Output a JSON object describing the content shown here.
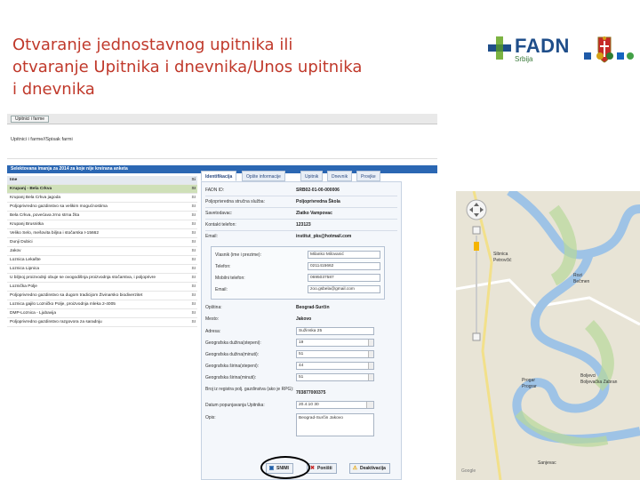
{
  "slide": {
    "title": "Otvaranje jednostavnog upitnika ili otvaranje Upitnika i dnevnika/Unos upitnika i dnevnika",
    "title_color": "#c0392b"
  },
  "logo": {
    "text": "FADN",
    "sub": "Srbija",
    "icon": "fadn-cross-icon"
  },
  "app": {
    "menu_button": "Upitnici i farme",
    "breadcrumb": "Upitnici i farme//Spisak farmi",
    "selection_bar": "Selektovana imanja za 2014 za koje nije kreirana anketa",
    "farm_header": {
      "name": "Ime",
      "code": "Si"
    },
    "farms": [
      {
        "name": "Krupanj - Bela Crkva",
        "code": "SI",
        "selected": true
      },
      {
        "name": "Krupanj Bela Crkva jagoda",
        "code": "SI"
      },
      {
        "name": "Poljoprivredno gazdinstvo sa velikim mogućnostima",
        "code": "SI"
      },
      {
        "name": "Bela Crkva, povećava zrno strna žita",
        "code": "SI"
      },
      {
        "name": "Krupanj Brusnitka",
        "code": "SI"
      },
      {
        "name": "Veliko Selo, mešovita biljna i stočarska I-15662",
        "code": "SI"
      },
      {
        "name": "Dunji Dubici",
        "code": "SI"
      },
      {
        "name": "Jakov",
        "code": "SI"
      },
      {
        "name": "Loznica Lekašte",
        "code": "SI"
      },
      {
        "name": "Loznica Lipnica",
        "code": "SI"
      },
      {
        "name": "U biljnoj proizvodnji obuje se ovogodišnja proizvodnja stočarstva, i poljoprivre",
        "code": "SI"
      },
      {
        "name": "Loznička Polje",
        "code": "SI"
      },
      {
        "name": "Poljoprivredno gazdinstvo sa dugom tradicijom Živinarsko biodiverzitet",
        "code": "SI"
      },
      {
        "name": "Loznica gajilo Lozničko Polje, proizvodnja mleka 2-4005",
        "code": "SI"
      },
      {
        "name": "DMP-Loznica - Ljubavija",
        "code": "SI"
      },
      {
        "name": "Poljoprivredno gazdinstvo razgovora za saradnju",
        "code": "SI"
      }
    ],
    "tabs": [
      "Identifikacija",
      "Opšte informacije",
      "Upitnik",
      "Dnevnik",
      "Provjke"
    ],
    "fields": {
      "fadn_id": {
        "label": "FADN ID:",
        "value": "SRB02-01-00-000006"
      },
      "sluzba": {
        "label": "Poljoprivredna stručna služba:",
        "value": "Poljoprivredna Škola"
      },
      "savetodavac": {
        "label": "Savetodavac:",
        "value": "Zlatko Vampovac"
      },
      "telefon": {
        "label": "Kontakt telefon:",
        "value": "123123"
      },
      "email": {
        "label": "Email:",
        "value": "institut_pks@hotmail.com"
      }
    },
    "contact": {
      "vlasnik": {
        "label": "Vlasnik (ime i prezime):",
        "value": "Milanko Milovanić"
      },
      "telefon": {
        "label": "Telefon:",
        "value": "0211415662"
      },
      "mobilni": {
        "label": "Mobilni telefon:",
        "value": "0695037587"
      },
      "email": {
        "label": "Email:",
        "value": "zoo.gsbela@gmail.com"
      }
    },
    "location": {
      "opstina": {
        "label": "Opština:",
        "value": "Beograd-Surčin"
      },
      "mesto": {
        "label": "Mesto:",
        "value": "Jakovo"
      },
      "adresa": {
        "label": "Adresa:",
        "value": "Sužinska 25"
      },
      "duzina_st": {
        "label": "Geografska dužina(stepeni):",
        "value": "19"
      },
      "duzina_min": {
        "label": "Geografska dužina(minuti):",
        "value": "51"
      },
      "sirina_st": {
        "label": "Geografska širina(stepeni):",
        "value": "44"
      },
      "sirina_min": {
        "label": "Geografska širina(minuti):",
        "value": "51"
      },
      "broj": {
        "label": "Broj iz registra polj. gazdinstva (ako je RPG):",
        "value": "703877000375"
      },
      "datum": {
        "label": "Datum popunjavanja Upitnika:",
        "value": "20.4.10 30"
      },
      "opis": {
        "label": "Opis:",
        "value": "Beograd-Surčin Jakovo"
      }
    },
    "buttons": {
      "save": "SNIMI",
      "cancel": "Poništi",
      "deactivate": "Deaktivacija"
    }
  },
  "map": {
    "labels": [
      "Sibnica",
      "Rozi",
      "Bečmen",
      "Petrovčić",
      "Boljevci",
      "Progar",
      "Boljevačka Zabran",
      "Prograr",
      "Sanjevac",
      "Google"
    ]
  }
}
